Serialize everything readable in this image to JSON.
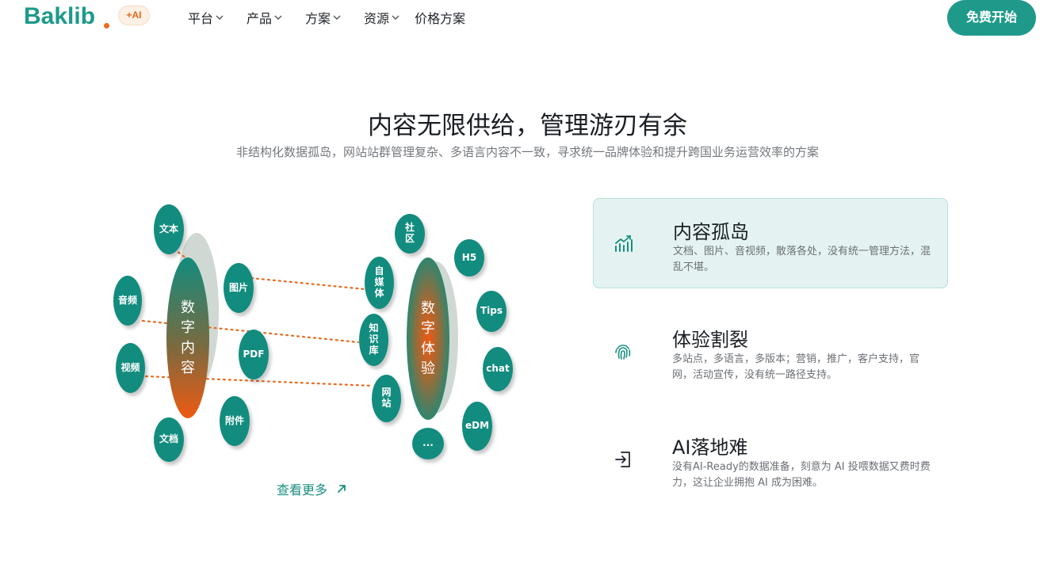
{
  "header": {
    "logo_text": "Baklib",
    "ai_badge": "+AI",
    "nav": [
      {
        "label": "平台",
        "has_dropdown": true
      },
      {
        "label": "产品",
        "has_dropdown": true
      },
      {
        "label": "方案",
        "has_dropdown": true
      },
      {
        "label": "资源",
        "has_dropdown": true
      },
      {
        "label": "价格方案",
        "has_dropdown": false
      }
    ],
    "cta_label": "免费开始"
  },
  "hero": {
    "title": "内容无限供给，管理游刃有余",
    "subtitle": "非结构化数据孤岛，网站站群管理复杂、多语言内容不一致，寻求统一品牌体验和提升跨国业务运营效率的方案"
  },
  "diagram": {
    "left_center": "数字内容",
    "right_center": "数字体验",
    "left_bubbles": [
      "文本",
      "音频",
      "视频",
      "文档",
      "图片",
      "PDF",
      "附件"
    ],
    "middle_bubbles": [
      "自媒体",
      "知识库",
      "网站"
    ],
    "right_bubbles": [
      "社区",
      "H5",
      "Tips",
      "chat",
      "eDM",
      "..."
    ]
  },
  "more_link": "查看更多",
  "cards": [
    {
      "title": "内容孤岛",
      "desc": "文档、图片、音视频，散落各处，没有统一管理方法，混乱不堪。",
      "icon": "chart-growth-icon",
      "active": true
    },
    {
      "title": "体验割裂",
      "desc": "多站点，多语言，多版本；营销，推广，客户支持，官网，活动宣传，没有统一路径支持。",
      "icon": "fingerprint-icon",
      "active": false
    },
    {
      "title": "AI落地难",
      "desc": "没有AI-Ready的数据准备，刻意为 AI 投喂数据又费时费力，这让企业拥抱 AI 成为困难。",
      "icon": "login-arrow-icon",
      "active": false
    }
  ],
  "colors": {
    "brand": "#1f9a8a",
    "accent_orange": "#ee6a1f",
    "bubble": "#128c7e",
    "card_active_bg": "#e4f3f1"
  }
}
